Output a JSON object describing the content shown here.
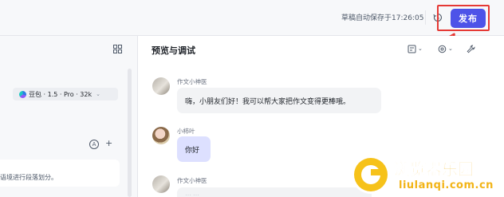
{
  "header": {
    "draft_status": "草稿自动保存于17:26:05",
    "history_icon": "history-icon",
    "publish_label": "发布",
    "highlight_color": "#e53935",
    "publish_color": "#4d53e8"
  },
  "left_panel": {
    "layout_icon": "grid-icon",
    "model_label": "豆包 · 1.5 · Pro · 32k",
    "model_chevron": "⌄",
    "circle_a": "A",
    "add_label": "+",
    "prompt_snippet": "语境进行段落划分。"
  },
  "preview": {
    "title": "预览与调试",
    "tools": [
      "layout-select-icon",
      "plugin-icon",
      "wrench-icon"
    ],
    "messages": [
      {
        "role": "bot",
        "sender": "作文小神医",
        "text": "嗨，小朋友们好！我可以帮大家把作文变得更棒哦。"
      },
      {
        "role": "user",
        "sender": "小柿叶",
        "text": "你好"
      },
      {
        "role": "bot",
        "sender": "作文小神医",
        "text": "……"
      }
    ]
  },
  "watermark": {
    "title": "浏览器乐园",
    "url": "liulanqi.com.cn",
    "color": "#f2b417"
  }
}
